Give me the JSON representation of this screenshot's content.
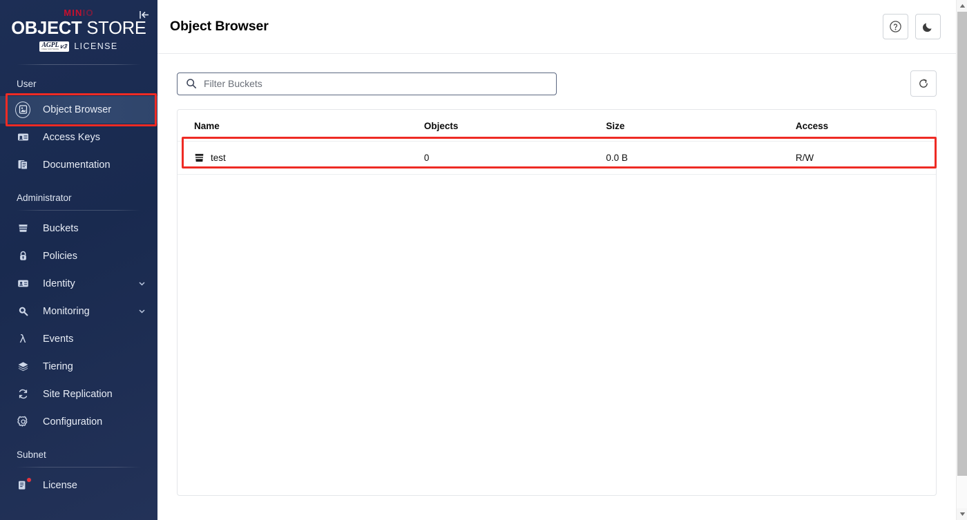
{
  "sidebar": {
    "collapse_icon": "collapse-left-icon",
    "logo": {
      "brand_min": "MIN",
      "brand_io": "IO",
      "object": "OBJECT",
      "store": "STORE",
      "badge_text": "AGPL",
      "badge_sub": "FREE SOFTWARE",
      "badge_version": "v3",
      "license_text": "LICENSE"
    },
    "sections": [
      {
        "label": "User",
        "items": [
          {
            "label": "Object Browser",
            "icon": "object-browser-icon",
            "selected": true,
            "highlighted": true
          },
          {
            "label": "Access Keys",
            "icon": "access-keys-icon",
            "selected": false
          },
          {
            "label": "Documentation",
            "icon": "documentation-icon",
            "selected": false
          }
        ]
      },
      {
        "label": "Administrator",
        "items": [
          {
            "label": "Buckets",
            "icon": "bucket-icon",
            "selected": false
          },
          {
            "label": "Policies",
            "icon": "lock-icon",
            "selected": false
          },
          {
            "label": "Identity",
            "icon": "identity-card-icon",
            "selected": false,
            "expandable": true
          },
          {
            "label": "Monitoring",
            "icon": "magnifier-icon",
            "selected": false,
            "expandable": true
          },
          {
            "label": "Events",
            "icon": "lambda-icon",
            "selected": false
          },
          {
            "label": "Tiering",
            "icon": "layers-icon",
            "selected": false
          },
          {
            "label": "Site Replication",
            "icon": "replication-icon",
            "selected": false
          },
          {
            "label": "Configuration",
            "icon": "gear-icon",
            "selected": false
          }
        ]
      },
      {
        "label": "Subnet",
        "items": [
          {
            "label": "License",
            "icon": "license-icon",
            "selected": false,
            "badge": true
          }
        ]
      }
    ]
  },
  "header": {
    "title": "Object Browser",
    "help_icon": "help-circle-icon",
    "theme_icon": "moon-icon"
  },
  "toolbar": {
    "search_icon": "search-icon",
    "search_placeholder": "Filter Buckets",
    "search_value": "",
    "refresh_icon": "refresh-icon"
  },
  "table": {
    "columns": [
      "Name",
      "Objects",
      "Size",
      "Access"
    ],
    "rows": [
      {
        "name": "test",
        "icon": "bucket-icon",
        "objects": "0",
        "size": "0.0 B",
        "access": "R/W",
        "highlighted": true
      }
    ]
  },
  "colors": {
    "sidebar_bg": "#1d2e55",
    "sidebar_selected": "#2f456b",
    "brand_red": "#c8102e",
    "annotation_red": "#ee2b24",
    "accent_border": "#5b6780"
  }
}
